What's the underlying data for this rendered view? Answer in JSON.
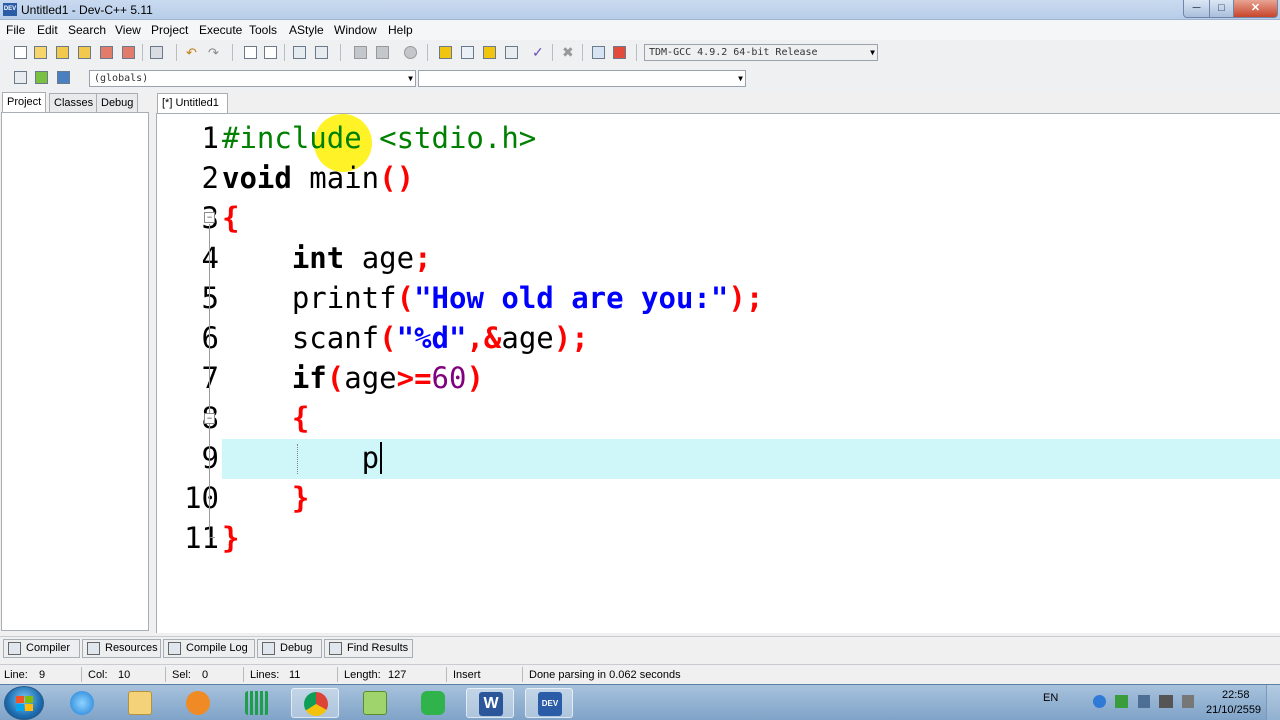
{
  "window": {
    "app_icon": "DEV",
    "title": "Untitled1 - Dev-C++ 5.11",
    "min_glyph": "─",
    "max_glyph": "□",
    "close_glyph": "✕"
  },
  "menu": [
    "File",
    "Edit",
    "Search",
    "View",
    "Project",
    "Execute",
    "Tools",
    "AStyle",
    "Window",
    "Help"
  ],
  "toolbar": {
    "compiler_select": "TDM-GCC 4.9.2 64-bit Release",
    "scope_select": "(globals)",
    "function_select": "",
    "icons": [
      "new-file-icon",
      "open-icon",
      "save-icon",
      "save-all-icon",
      "close-file-icon",
      "close-all-icon",
      "print-icon",
      "undo-icon",
      "redo-icon",
      "find-icon",
      "replace-icon",
      "indent-icon",
      "unindent-icon",
      "goto-back-icon",
      "goto-forward-icon",
      "toggle-bookmark-icon",
      "compile-icon",
      "run-icon",
      "compile-run-icon",
      "rebuild-icon",
      "syntax-check-icon",
      "stop-icon",
      "chart-icon",
      "debug-icon"
    ]
  },
  "left_panel": {
    "tabs": [
      "Project",
      "Classes",
      "Debug"
    ],
    "active_tab": "Project"
  },
  "editor": {
    "tab_label": "[*] Untitled1",
    "current_line": 9,
    "lines": [
      {
        "num": "1",
        "parts": [
          [
            "c-pre",
            "#include <stdio.h>"
          ]
        ]
      },
      {
        "num": "2",
        "parts": [
          [
            "c-kw",
            "void"
          ],
          [
            "c-id",
            " main"
          ],
          [
            "c-red",
            "()"
          ]
        ]
      },
      {
        "num": "3",
        "parts": [
          [
            "c-red",
            "{"
          ]
        ]
      },
      {
        "num": "4",
        "parts": [
          [
            "c-id",
            "    "
          ],
          [
            "c-kw",
            "int"
          ],
          [
            "c-id",
            " age"
          ],
          [
            "c-red",
            ";"
          ]
        ]
      },
      {
        "num": "5",
        "parts": [
          [
            "c-id",
            "    printf"
          ],
          [
            "c-red",
            "("
          ],
          [
            "c-str",
            "\"How old are you:\""
          ],
          [
            "c-red",
            ");"
          ]
        ]
      },
      {
        "num": "6",
        "parts": [
          [
            "c-id",
            "    scanf"
          ],
          [
            "c-red",
            "("
          ],
          [
            "c-str",
            "\"%d\""
          ],
          [
            "c-red",
            ",&"
          ],
          [
            "c-id",
            "age"
          ],
          [
            "c-red",
            ");"
          ]
        ]
      },
      {
        "num": "7",
        "parts": [
          [
            "c-id",
            "    "
          ],
          [
            "c-kw",
            "if"
          ],
          [
            "c-red",
            "("
          ],
          [
            "c-id",
            "age"
          ],
          [
            "c-red",
            ">="
          ],
          [
            "c-num",
            "60"
          ],
          [
            "c-red",
            ")"
          ]
        ]
      },
      {
        "num": "8",
        "parts": [
          [
            "c-id",
            "    "
          ],
          [
            "c-red",
            "{"
          ]
        ]
      },
      {
        "num": "9",
        "parts": [
          [
            "c-id",
            "        p"
          ]
        ]
      },
      {
        "num": "10",
        "parts": [
          [
            "c-id",
            "    "
          ],
          [
            "c-red",
            "}"
          ]
        ]
      },
      {
        "num": "11",
        "parts": [
          [
            "c-red",
            "}"
          ]
        ]
      }
    ],
    "fold_glyph": "−"
  },
  "bottom_tabs": [
    {
      "label": "Compiler",
      "icon": "compiler-icon"
    },
    {
      "label": "Resources",
      "icon": "resources-icon"
    },
    {
      "label": "Compile Log",
      "icon": "compile-log-icon"
    },
    {
      "label": "Debug",
      "icon": "debug-tab-icon"
    },
    {
      "label": "Find Results",
      "icon": "find-results-icon"
    }
  ],
  "status": {
    "line_label": "Line:",
    "line_val": "9",
    "col_label": "Col:",
    "col_val": "10",
    "sel_label": "Sel:",
    "sel_val": "0",
    "lines_label": "Lines:",
    "lines_val": "11",
    "length_label": "Length:",
    "length_val": "127",
    "mode": "Insert",
    "message": "Done parsing in 0.062 seconds"
  },
  "taskbar": {
    "apps": [
      "start-orb-icon",
      "internet-explorer-icon",
      "file-explorer-icon",
      "media-player-icon",
      "calculator-icon",
      "chrome-icon",
      "folder-icon",
      "line-icon",
      "word-icon",
      "devcpp-icon"
    ],
    "lang": "EN",
    "time": "22:58",
    "date": "21/10/2559"
  },
  "colors": {
    "current_line": "#cff6f9",
    "string": "#0000ff",
    "symbol": "#ff0000",
    "number": "#800080",
    "preprocessor": "#008000"
  }
}
